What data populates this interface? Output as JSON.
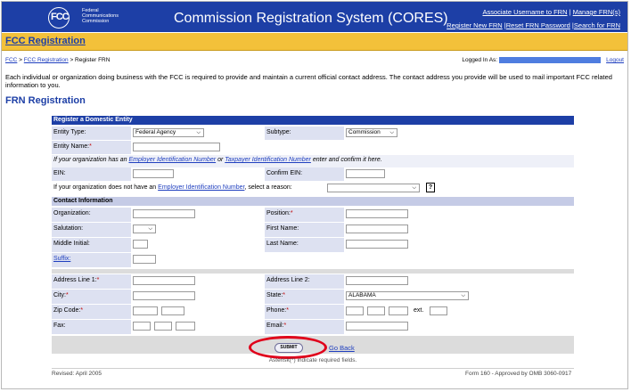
{
  "header": {
    "logo_text": "FCC",
    "logo_lines": [
      "Federal",
      "Communications",
      "Commission"
    ],
    "title": "Commission Registration System (CORES)",
    "links_row1": [
      "Associate Username to FRN",
      "Manage FRN(s)"
    ],
    "links_row2": [
      "Register New FRN",
      "Reset FRN Password",
      "Search for FRN"
    ]
  },
  "bar_title": "FCC Registration",
  "breadcrumb": {
    "home": "FCC",
    "sep": ">",
    "parent": "FCC Registration",
    "current": "> Register FRN"
  },
  "login": {
    "label": "Logged In As:",
    "logout": "Logout"
  },
  "intro": "Each individual or organization doing business with the FCC is required to provide and maintain a current official contact address. The contact address you provide will be used to mail important FCC related information to you.",
  "page_heading": "FRN Registration",
  "form": {
    "section1": "Register a Domestic Entity",
    "entity_type_label": "Entity Type:",
    "entity_type_value": "Federal Agency",
    "subtype_label": "Subtype:",
    "subtype_value": "Commission",
    "entity_name_label": "Entity Name:",
    "ein_note_prefix": "If your organization has an",
    "ein_note_link1": "Employer Identification Number",
    "ein_note_or": "or",
    "ein_note_link2": "Taxpayer Identification Number",
    "ein_note_suffix": "enter and confirm it here.",
    "ein_label": "EIN:",
    "confirm_ein_label": "Confirm EIN:",
    "no_ein_prefix": "If your organization does not have an",
    "no_ein_link": "Employer Identification Number",
    "no_ein_suffix": ", select a reason:",
    "help_glyph": "?",
    "section2": "Contact Information",
    "organization_label": "Organization:",
    "position_label": "Position:",
    "salutation_label": "Salutation:",
    "first_name_label": "First Name:",
    "middle_initial_label": "Middle Initial:",
    "last_name_label": "Last Name:",
    "suffix_label": "Suffix:",
    "address1_label": "Address Line 1:",
    "address2_label": "Address Line 2:",
    "city_label": "City:",
    "state_label": "State:",
    "state_value": "ALABAMA",
    "zip_label": "Zip Code:",
    "phone_label": "Phone:",
    "ext_label": "ext.",
    "fax_label": "Fax:",
    "email_label": "Email:",
    "required_mark": "*",
    "submit_label": "SUBMIT",
    "go_back": "Go Back",
    "asterisk_note": "Asterisk(*) indicate required fields."
  },
  "footer": {
    "revised": "Revised: April 2005",
    "form_info": "Form 160 - Approved by OMB 3060-0917"
  },
  "colors": {
    "header_blue": "#1d3fa6",
    "bar_gold": "#f3c13a",
    "highlight_red": "#e0001a"
  }
}
